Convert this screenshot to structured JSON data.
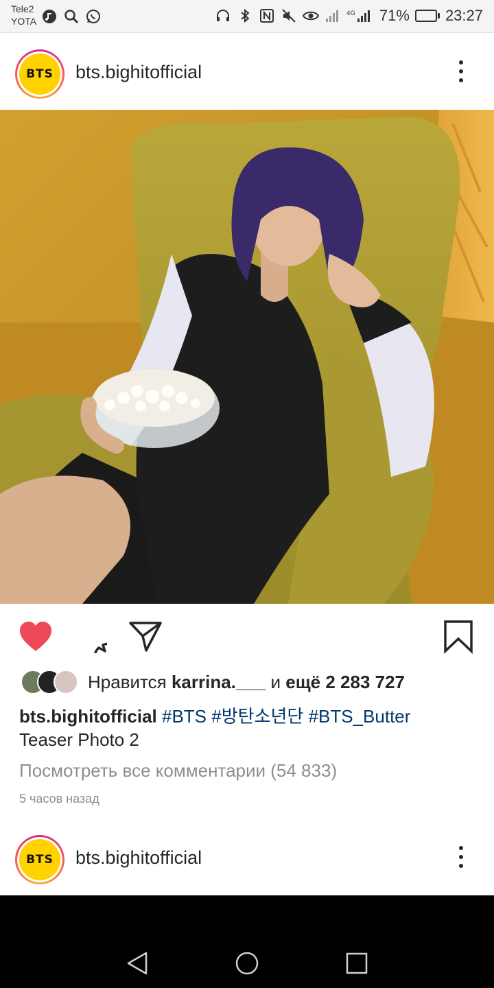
{
  "status_bar": {
    "carrier_1": "Tele2",
    "carrier_2": "YOTA",
    "network_label": "4G",
    "battery_percent": "71%",
    "battery_level": 0.71,
    "time": "23:27"
  },
  "post": {
    "avatar_text": "BTS",
    "username": "bts.bighitofficial",
    "likes": {
      "prefix": "Нравится ",
      "user": "karrina.___",
      "middle": " и ",
      "count_text": "ещё 2 283 727"
    },
    "caption": {
      "user": "bts.bighitofficial",
      "tags": [
        "#BTS",
        "#방탄소년단",
        "#BTS_Butter"
      ],
      "line2": "Teaser Photo 2"
    },
    "view_comments": "Посмотреть все комментарии (54 833)",
    "time_ago": "5 часов назад",
    "liked": true
  },
  "next_post": {
    "avatar_text": "BTS",
    "username": "bts.bighitofficial"
  },
  "colors": {
    "like_red": "#ed4956",
    "hashtag_blue": "#00376b",
    "muted_gray": "#8e8e8e",
    "avatar_yellow": "#ffd200"
  },
  "icons": {
    "like": "heart-icon",
    "comment": "comment-icon",
    "share": "paper-plane-icon",
    "save": "bookmark-icon",
    "more": "more-vertical-icon",
    "nav_back": "back-triangle-icon",
    "nav_home": "home-circle-icon",
    "nav_recents": "recents-square-icon"
  }
}
